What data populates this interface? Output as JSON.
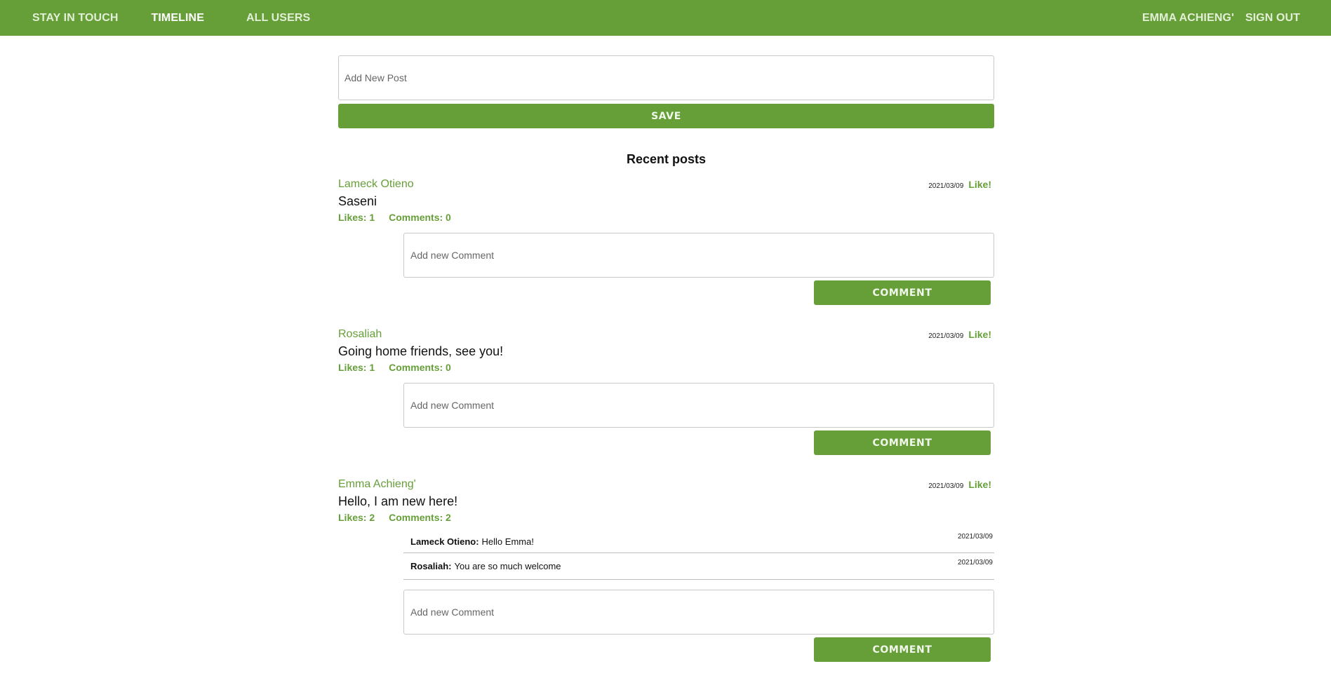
{
  "nav": {
    "brand": "STAY IN TOUCH",
    "timeline": "TIMELINE",
    "all_users": "ALL USERS",
    "current_user": "EMMA ACHIENG'",
    "sign_out": "SIGN OUT"
  },
  "new_post": {
    "placeholder": "Add New Post",
    "save_label": "SAVE"
  },
  "recent_title": "Recent posts",
  "posts": [
    {
      "author": "Lameck Otieno",
      "date": "2021/03/09",
      "like_label": "Like!",
      "body": "Saseni",
      "likes": "Likes: 1",
      "comments_count": "Comments: 0",
      "comment_placeholder": "Add new Comment",
      "comment_button": "COMMENT"
    },
    {
      "author": "Rosaliah",
      "date": "2021/03/09",
      "like_label": "Like!",
      "body": "Going home friends, see you!",
      "likes": "Likes: 1",
      "comments_count": "Comments: 0",
      "comment_placeholder": "Add new Comment",
      "comment_button": "COMMENT"
    },
    {
      "author": "Emma Achieng'",
      "date": "2021/03/09",
      "like_label": "Like!",
      "body": "Hello, I am new here!",
      "likes": "Likes: 2",
      "comments_count": "Comments: 2",
      "comments": [
        {
          "author": "Lameck Otieno:",
          "text": "Hello Emma!",
          "date": "2021/03/09"
        },
        {
          "author": "Rosaliah:",
          "text": "You are so much welcome",
          "date": "2021/03/09"
        }
      ],
      "comment_placeholder": "Add new Comment",
      "comment_button": "COMMENT"
    }
  ],
  "colors": {
    "brand_green": "#669f38"
  }
}
